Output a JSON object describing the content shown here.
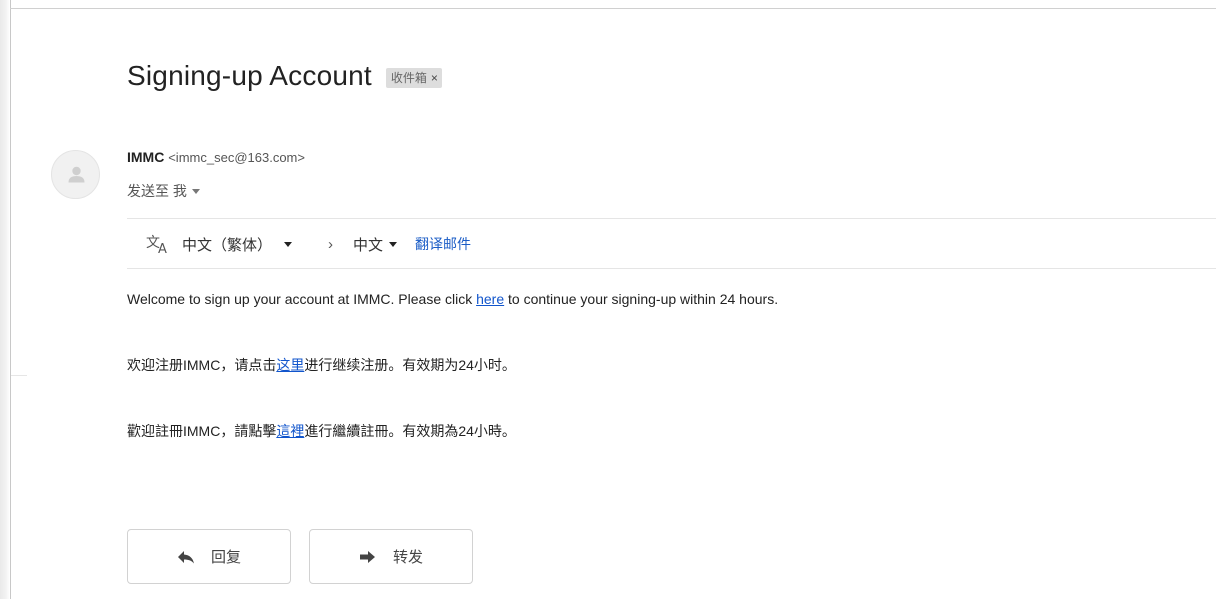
{
  "email": {
    "subject": "Signing-up Account",
    "label": "收件箱",
    "label_close": "×"
  },
  "sender": {
    "name": "IMMC",
    "email": "<immc_sec@163.com>",
    "recipient_text": "发送至 我"
  },
  "translate_bar": {
    "source_language": "中文（繁体）",
    "arrow": "›",
    "target_language": "中文",
    "translate_action": "翻译邮件"
  },
  "body": {
    "english": {
      "before": "Welcome to sign up your account at IMMC. Please click ",
      "link": "here",
      "after": " to continue your signing-up within 24 hours."
    },
    "simplified": {
      "before": "欢迎注册IMMC，请点击",
      "link": "这里",
      "after": "进行继续注册。有效期为24小时。"
    },
    "traditional": {
      "before": "歡迎註冊IMMC，請點擊",
      "link": "這裡",
      "after": "進行繼續註冊。有效期為24小時。"
    }
  },
  "actions": {
    "reply_label": "回复",
    "forward_label": "转发"
  },
  "colors": {
    "link": "#1155cc",
    "translate_link": "#1a5cc6",
    "label_chip_bg": "#dddddd"
  }
}
